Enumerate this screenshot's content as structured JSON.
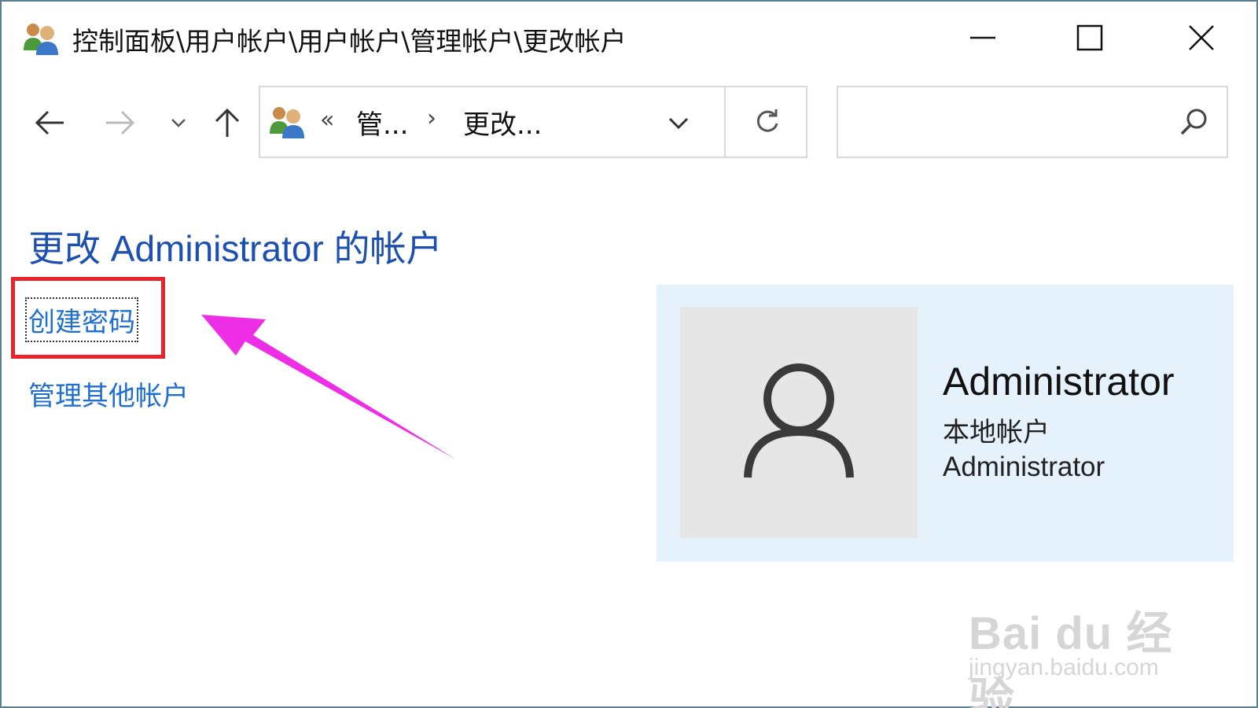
{
  "window": {
    "title": "控制面板\\用户帐户\\用户帐户\\管理帐户\\更改帐户",
    "controls": {
      "minimize": "minimize-icon",
      "maximize": "maximize-icon",
      "close": "close-icon"
    }
  },
  "nav": {
    "back_icon": "arrow-left-icon",
    "forward_icon": "arrow-right-icon",
    "recent_icon": "chevron-down-icon",
    "up_icon": "arrow-up-icon"
  },
  "address_bar": {
    "overflow": "«",
    "crumbs": [
      "管...",
      "更改..."
    ],
    "separator": "›"
  },
  "search": {
    "value": "",
    "placeholder": ""
  },
  "content": {
    "title": "更改 Administrator 的帐户",
    "links": [
      "创建密码",
      "管理其他帐户"
    ]
  },
  "account": {
    "name": "Administrator",
    "type": "本地帐户",
    "group": "Administrator"
  },
  "annotation": {
    "highlight_color": "#e8252c",
    "arrow_color": "#ee2ee6"
  },
  "watermark": {
    "brand": "Bai du 经验",
    "url": "jingyan.baidu.com"
  },
  "colors": {
    "title_blue": "#1c4fb0",
    "link_blue": "#1f6fd0",
    "panel_bg": "#e5f1fb"
  }
}
